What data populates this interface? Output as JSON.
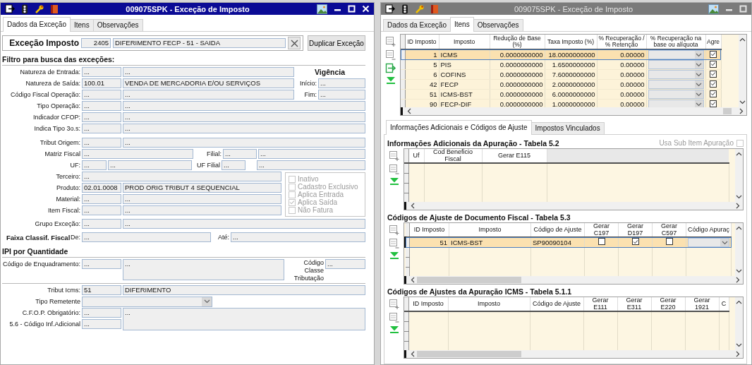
{
  "windows": [
    {
      "kind": "exception_form",
      "title": "009075SPK - Exceção de Imposto",
      "active": true,
      "close_button": true,
      "tabs": [
        {
          "label": "Dados da Exceção",
          "selected": true
        },
        {
          "label": "Itens",
          "selected": false
        },
        {
          "label": "Observações",
          "selected": false
        }
      ],
      "header": {
        "label": "Exceção Imposto",
        "code": "2405",
        "description": "DIFERIMENTO FECP - 51 - SAIDA",
        "action": "Duplicar Exceção"
      },
      "filter": {
        "title": "Filtro para busca das exceções:",
        "lookups": [
          {
            "label": "Natureza de Entrada:",
            "code": "...",
            "description": "..."
          },
          {
            "label": "Natureza de Saída:",
            "code": "100.01",
            "description": "VENDA DE MERCADORIA E/OU SERVIÇOS"
          },
          {
            "label": "Código Fiscal Operação:",
            "code": "...",
            "description": "..."
          },
          {
            "label": "Tipo Operação:",
            "code": "...",
            "description": "..."
          },
          {
            "label": "Indicador CFOP:",
            "code": "...",
            "description": "..."
          },
          {
            "label": "Indica Tipo 3o.s:",
            "code": "...",
            "description": "..."
          },
          {
            "label": "Tribut Origem:",
            "code": "...",
            "description": "..."
          }
        ],
        "validity": {
          "heading": "Vigência",
          "start": {
            "label": "Início:",
            "value": "..."
          },
          "end": {
            "label": "Fim:",
            "value": "..."
          }
        },
        "matriz": {
          "label": "Matriz Fiscal",
          "value": "..."
        },
        "filial": {
          "label": "Filial:",
          "code": "...",
          "description": "..."
        },
        "uf": {
          "label": "UF:",
          "code": "...",
          "description": "..."
        },
        "uf_filial": {
          "label": "UF Filial",
          "code": "...",
          "description": "..."
        },
        "terceiro": {
          "label": "Terceiro:",
          "value": "..."
        },
        "products": [
          {
            "label": "Produto:",
            "code": "02.01.0008",
            "description": "PROD ORIG TRIBUT 4 SEQUENCIAL"
          },
          {
            "label": "Material:",
            "code": "...",
            "description": "..."
          },
          {
            "label": "Item Fiscal:",
            "code": "...",
            "description": "..."
          }
        ],
        "options": [
          {
            "label": "Inativo",
            "checked": false,
            "disabled": true
          },
          {
            "label": "Cadastro Exclusivo",
            "checked": false,
            "disabled": true
          },
          {
            "label": "Aplica Entrada",
            "checked": false,
            "disabled": true
          },
          {
            "label": "Aplica Saída",
            "checked": true,
            "disabled": true
          },
          {
            "label": "Não Fatura",
            "checked": false,
            "disabled": true
          }
        ],
        "group": {
          "label": "Grupo Exceção:",
          "code": "...",
          "description": "..."
        }
      },
      "range": {
        "title": "Faixa Classif. Fiscal",
        "from": {
          "label": "De:",
          "value": "..."
        },
        "to": {
          "label": "Até:",
          "value": "..."
        }
      },
      "ipi": {
        "title": "IPI por Quantidade",
        "framing": {
          "label": "Código de Enquadramento:",
          "code": "...",
          "description": "..."
        },
        "class": {
          "label": "Código Classe Tributação",
          "value": "..."
        }
      },
      "icms": {
        "tribut": {
          "label": "Tribut Icms:",
          "code": "51",
          "description": "DIFERIMENTO"
        },
        "sender_type": {
          "label": "Tipo Remetente"
        },
        "cfop": {
          "label": "C.F.O.P. Obrigatório:",
          "code": "...",
          "description": "..."
        },
        "additional": {
          "label": "5.6 - Código Inf.Adicional",
          "code": "..."
        }
      }
    },
    {
      "kind": "items_form",
      "title": "009075SPK - Exceção de Imposto",
      "active": false,
      "close_button": false,
      "tabs": [
        {
          "label": "Dados da Exceção",
          "selected": false
        },
        {
          "label": "Itens",
          "selected": true
        },
        {
          "label": "Observações",
          "selected": false
        }
      ],
      "items_grid": {
        "columns": [
          "ID Imposto",
          "Imposto",
          "Redução de Base (%)",
          "Taxa Imposto (%)",
          "% Recuperação / % Retenção",
          "% Recuperação na base ou alíquota",
          "Agre"
        ],
        "rows": [
          {
            "id": "1",
            "tax": "ICMS",
            "base_reduction": "0.0000000000",
            "rate": "18.0000000000",
            "recovery": "0.00000",
            "aggregate": true,
            "selected": true
          },
          {
            "id": "5",
            "tax": "PIS",
            "base_reduction": "0.0000000000",
            "rate": "1.6500000000",
            "recovery": "0.00000",
            "aggregate": true,
            "selected": false
          },
          {
            "id": "6",
            "tax": "COFINS",
            "base_reduction": "0.0000000000",
            "rate": "7.6000000000",
            "recovery": "0.00000",
            "aggregate": true,
            "selected": false
          },
          {
            "id": "42",
            "tax": "FECP",
            "base_reduction": "0.0000000000",
            "rate": "2.0000000000",
            "recovery": "0.00000",
            "aggregate": true,
            "selected": false
          },
          {
            "id": "51",
            "tax": "ICMS-BST",
            "base_reduction": "0.0000000000",
            "rate": "6.0000000000",
            "recovery": "0.00000",
            "aggregate": true,
            "selected": false
          },
          {
            "id": "90",
            "tax": "FECP-DIF",
            "base_reduction": "0.0000000000",
            "rate": "1.0000000000",
            "recovery": "0.00000",
            "aggregate": true,
            "selected": false
          }
        ]
      },
      "subtabs": [
        {
          "label": "Informações Adicionais e Códigos de Ajuste",
          "selected": true
        },
        {
          "label": "Impostos Vinculados",
          "selected": false
        }
      ],
      "additional_info": {
        "title": "Informações Adicionais da Apuração - Tabela 5.2",
        "option": {
          "label": "Usa Sub Item Apuração",
          "checked": false,
          "disabled": true
        },
        "columns": [
          "Uf",
          "Cod Beneficio Fiscal",
          "Gerar E115"
        ]
      },
      "document_adjustments": {
        "title": "Códigos de Ajuste de Documento Fiscal - Tabela 5.3",
        "columns": [
          "ID Imposto",
          "Imposto",
          "Código de Ajuste",
          "Gerar C197",
          "Gerar D197",
          "Gerar C597",
          "Código Apuraç"
        ],
        "rows": [
          {
            "id": "51",
            "tax": "ICMS-BST",
            "code": "SP90090104",
            "c197": false,
            "d197": true,
            "c597": false,
            "selected": true
          }
        ]
      },
      "assessment_adjustments": {
        "title": "Códigos de Ajustes da Apuração ICMS - Tabela 5.1.1",
        "columns": [
          "ID Imposto",
          "Imposto",
          "Código de Ajuste",
          "Gerar E111",
          "Gerar E311",
          "Gerar E220",
          "Gerar 1921",
          "C"
        ]
      }
    }
  ]
}
